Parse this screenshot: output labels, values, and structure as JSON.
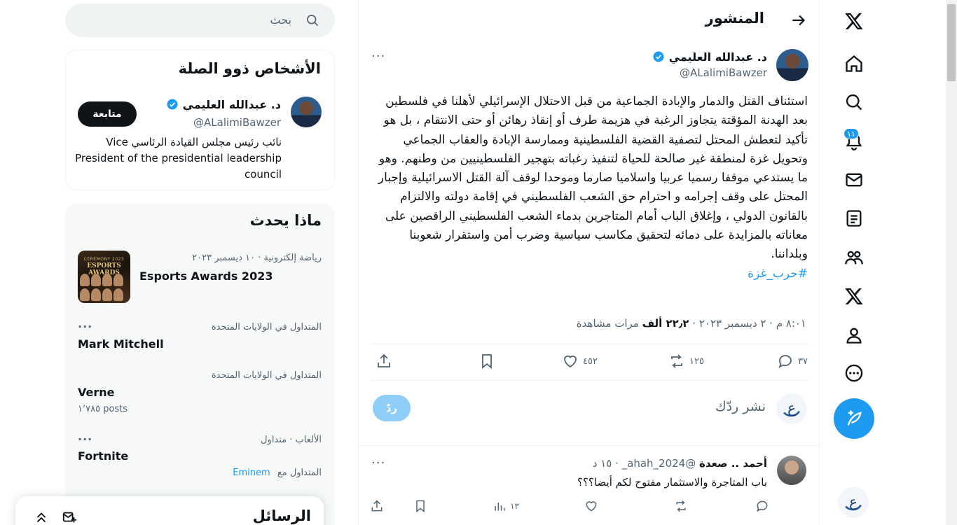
{
  "nav": {
    "notifications_badge": "١١",
    "items": [
      "x-logo",
      "home",
      "explore",
      "notifications",
      "messages",
      "lists",
      "communities",
      "premium",
      "profile",
      "more"
    ]
  },
  "header": {
    "title": "المنشور"
  },
  "tweet": {
    "author_name": "د. عبدالله العليمي",
    "author_handle": "@ALalimiBawzer",
    "text_paragraph_1": "استئناف القتل والدمار والإبادة الجماعية من قبل الاحتلال الإسرائيلي لأهلنا في فلسطين بعد الهدنة المؤقتة يتجاوز الرغبة في هزيمة طرف أو إنقاذ رهائن أو حتى الانتقام ، بل هو تأكيد لتعطش المحتل لتصفية القضية الفلسطينية وممارسة الإبادة والعقاب الجماعي وتحويل غزة لمنطقة غير صالحة للحياة لتنفيذ رغباته بتهجير الفلسطينيين من وطنهم.",
    "text_paragraph_2": "وهو ما يستدعي موقفا رسميا عربيا واسلاميا صارما وموحدا لوقف آلة القتل الاسرائيلية وإجبار المحتل على وقف إجرامه و احترام حق الشعب الفلسطيني في إقامة دولته والالتزام بالقانون الدولي ، وإغلاق الباب أمام المتاجرين بدماء الشعب الفلسطيني الراقصين على معاناته بالمزايدة على دمائه لتحقيق مكاسب سياسية وضرب أمن واستقرار شعوبنا وبلداننا.",
    "hashtag": "#حرب_غزة",
    "time": "٨:٠١ م",
    "date": "٢ ديسمبر ٢٠٢٣",
    "views_count": "٢٢٫٢ ألف",
    "views_label": "مرات مشاهدة",
    "stats": {
      "replies": "٣٧",
      "reposts": "١٢٥",
      "likes": "٤٥٢"
    }
  },
  "composer": {
    "placeholder": "نشر ردّك",
    "button_label": "ردّ"
  },
  "reply": {
    "name": "أحمد .. صعدة",
    "handle": "@ahah_2024_",
    "time": "١٥ د",
    "text": "باب المتاجرة والاستثمار مفتوح لكم أيضا؟؟؟",
    "views": "١٣"
  },
  "search": {
    "placeholder": "بحث"
  },
  "relevant": {
    "title": "الأشخاص ذوو الصلة",
    "name": "د. عبدالله العليمي",
    "handle": "@ALalimiBawzer",
    "bio": "نائب رئيس مجلس القيادة الرئاسي Vice President of the presidential leadership council",
    "follow_label": "متابعة"
  },
  "trends": {
    "title": "ماذا يحدث",
    "items": [
      {
        "context": "رياضة إلكترونية · ١٠ ديسمبر ٢٠٢٣",
        "name": "Esports Awards 2023",
        "image_line1": "CEREMONY 2023",
        "image_line2": "ESPORTS AWARDS"
      },
      {
        "context": "المتداول في الولايات المتحدة",
        "name": "Mark Mitchell"
      },
      {
        "context": "المتداول في الولايات المتحدة",
        "name": "Verne",
        "sub": "١٬٧٨٥ posts"
      },
      {
        "context": "الألعاب · متداول",
        "name": "Fortnite",
        "sub_prefix": "المتداول مع",
        "sub_link": "Eminem"
      }
    ]
  },
  "messages": {
    "title": "الرسائل"
  }
}
